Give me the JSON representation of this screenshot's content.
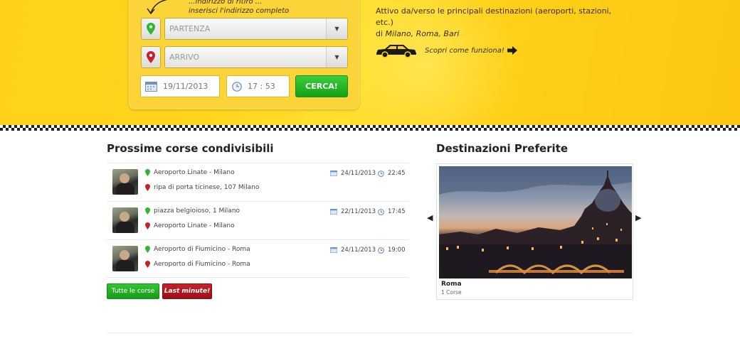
{
  "search": {
    "hint_line1": "...indirizzo di ritiro ...",
    "hint_line2": "inserisci l'indirizzo completo",
    "from_placeholder": "PARTENZA",
    "to_placeholder": "ARRIVO",
    "date_value": "19/11/2013",
    "time_value": "17 : 53",
    "submit_label": "CERCA!"
  },
  "info": {
    "line1": "Attivo da/verso le principali destinazioni (aeroporti, stazioni, etc.)",
    "line2_prefix": "di ",
    "line2_cities": "Milano, Roma, Bari",
    "discover_label": "Scopri come funziona!"
  },
  "rides": {
    "heading": "Prossime corse condivisibili",
    "items": [
      {
        "from": "Aeroporto Linate - Milano",
        "to": "ripa di porta ticinese, 107 Milano",
        "date": "24/11/2013",
        "time": "22:45"
      },
      {
        "from": "piazza belgioioso, 1 Milano",
        "to": "Aeroporto Linate - Milano",
        "date": "22/11/2013",
        "time": "17:45"
      },
      {
        "from": "Aeroporto di Fiumicino - Roma",
        "to": "Aeroporto di Fiumicino - Roma",
        "date": "24/11/2013",
        "time": "19:00"
      }
    ],
    "all_label": "Tutte le corse",
    "last_label": "Last minute!"
  },
  "destinations": {
    "heading": "Destinazioni Preferite",
    "card_title": "Roma",
    "card_sub": "1 Corse",
    "prev_glyph": "◀",
    "next_glyph": "▶"
  },
  "colors": {
    "accent_yellow": "#ffd11a",
    "green": "#22b022",
    "red": "#b0141a"
  }
}
